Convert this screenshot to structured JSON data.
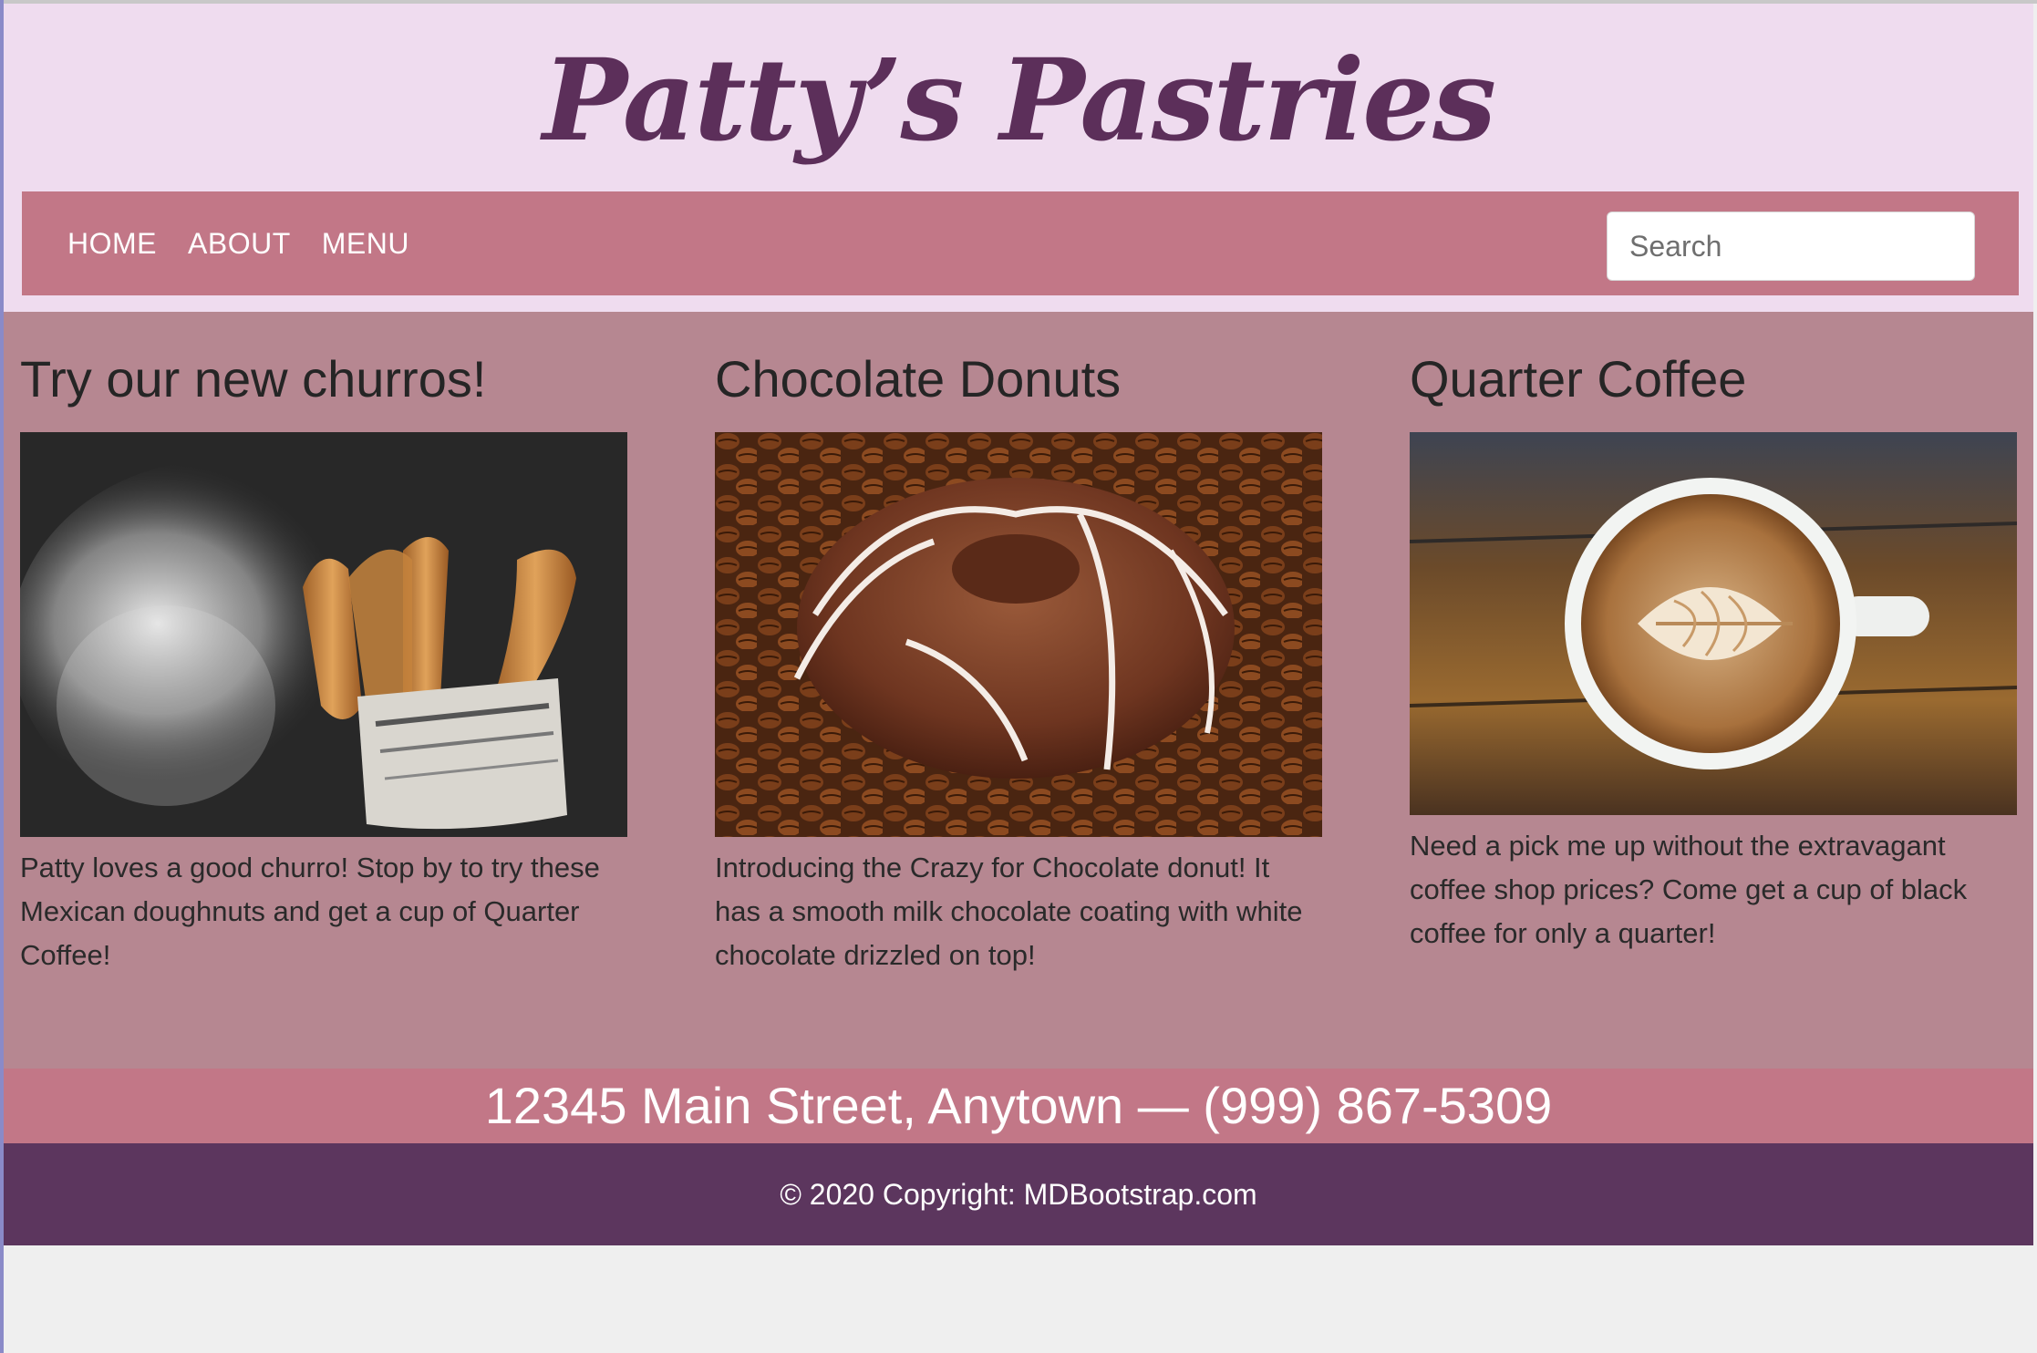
{
  "brand": {
    "title": "Patty’s Pastries"
  },
  "nav": {
    "links": [
      "HOME",
      "ABOUT",
      "MENU"
    ],
    "search_placeholder": "Search"
  },
  "cards": [
    {
      "title": "Try our new churros!",
      "image": "churros-photo",
      "text": "Patty loves a good churro! Stop by to try these Mexican doughnuts and get a cup of Quarter Coffee!"
    },
    {
      "title": "Chocolate Donuts",
      "image": "chocolate-donut-photo",
      "text": "Introducing the Crazy for Chocolate donut! It has a smooth milk chocolate coating with white chocolate drizzled on top!"
    },
    {
      "title": "Quarter Coffee",
      "image": "latte-photo",
      "text": "Need a pick me up without the extravagant coffee shop prices? Come get a cup of black coffee for only a quarter!"
    }
  ],
  "address": "12345 Main Street, Anytown — (999) 867-5309",
  "footer": {
    "copyright": "© 2020 Copyright: MDBootstrap.com"
  },
  "colors": {
    "header_bg": "#efdcef",
    "brand": "#5c2f5a",
    "navbar": "#c27787",
    "content_bg": "#b68791",
    "footer_bg": "#5c365e"
  }
}
